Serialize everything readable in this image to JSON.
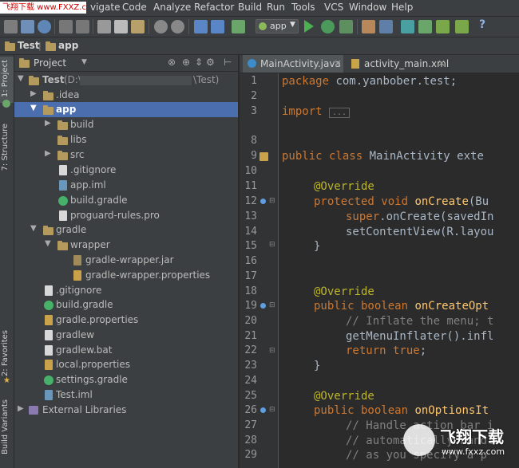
{
  "watermark": {
    "top": "飞翔下载 www.FXXZ.com",
    "bottom_title": "飞翔下载",
    "bottom_url": "www.fxxz.com"
  },
  "menu": [
    "vigate",
    "Code",
    "Analyze",
    "Refactor",
    "Build",
    "Run",
    "Tools",
    "VCS",
    "Window",
    "Help"
  ],
  "toolbar": {
    "run_config": "app",
    "help": "?"
  },
  "breadcrumb": [
    "Test",
    "app"
  ],
  "stripe": {
    "project": "1: Project",
    "structure": "7: Structure",
    "favorites": "2: Favorites",
    "build_variants": "Build Variants"
  },
  "panel": {
    "title": "Project"
  },
  "tree": [
    {
      "label": "Test",
      "label_suffix": "(D:\\",
      "label_end": "\\Test)",
      "depth": 0,
      "arrow": "▼",
      "icon": "folder-icon"
    },
    {
      "label": ".idea",
      "depth": 1,
      "arrow": "▶",
      "icon": "folder-icon"
    },
    {
      "label": "app",
      "depth": 1,
      "arrow": "▼",
      "icon": "folder-icon",
      "selected": true
    },
    {
      "label": "build",
      "depth": 2,
      "arrow": "▶",
      "icon": "folder-icon"
    },
    {
      "label": "libs",
      "depth": 2,
      "arrow": "",
      "icon": "folder-icon"
    },
    {
      "label": "src",
      "depth": 2,
      "arrow": "▶",
      "icon": "folder-icon"
    },
    {
      "label": ".gitignore",
      "depth": 2,
      "arrow": "",
      "icon": "file-icon"
    },
    {
      "label": "app.iml",
      "depth": 2,
      "arrow": "",
      "icon": "iml-icon"
    },
    {
      "label": "build.gradle",
      "depth": 2,
      "arrow": "",
      "icon": "gradle-icon"
    },
    {
      "label": "proguard-rules.pro",
      "depth": 2,
      "arrow": "",
      "icon": "file-icon"
    },
    {
      "label": "gradle",
      "depth": 1,
      "arrow": "▼",
      "icon": "folder-icon"
    },
    {
      "label": "wrapper",
      "depth": 2,
      "arrow": "▼",
      "icon": "folder-icon"
    },
    {
      "label": "gradle-wrapper.jar",
      "depth": 3,
      "arrow": "",
      "icon": "jar-icon"
    },
    {
      "label": "gradle-wrapper.properties",
      "depth": 3,
      "arrow": "",
      "icon": "properties-icon"
    },
    {
      "label": ".gitignore",
      "depth": 1,
      "arrow": "",
      "icon": "file-icon"
    },
    {
      "label": "build.gradle",
      "depth": 1,
      "arrow": "",
      "icon": "gradle-icon"
    },
    {
      "label": "gradle.properties",
      "depth": 1,
      "arrow": "",
      "icon": "properties-icon"
    },
    {
      "label": "gradlew",
      "depth": 1,
      "arrow": "",
      "icon": "file-icon"
    },
    {
      "label": "gradlew.bat",
      "depth": 1,
      "arrow": "",
      "icon": "file-icon"
    },
    {
      "label": "local.properties",
      "depth": 1,
      "arrow": "",
      "icon": "properties-icon"
    },
    {
      "label": "settings.gradle",
      "depth": 1,
      "arrow": "",
      "icon": "gradle-icon"
    },
    {
      "label": "Test.iml",
      "depth": 1,
      "arrow": "",
      "icon": "iml-icon"
    },
    {
      "label": "External Libraries",
      "depth": 0,
      "arrow": "▶",
      "icon": "library-icon"
    }
  ],
  "tabs": [
    {
      "label": "MainActivity.java",
      "close": "×",
      "active": true
    },
    {
      "label": "activity_main.xml",
      "close": "×",
      "active": false
    }
  ],
  "line_numbers": [
    "1",
    "2",
    "3",
    "8",
    "9",
    "10",
    "11",
    "12",
    "13",
    "14",
    "15",
    "16",
    "17",
    "18",
    "19",
    "20",
    "21",
    "22",
    "23",
    "24",
    "25",
    "26",
    "27",
    "28",
    "29"
  ],
  "code": {
    "l1_kw": "package",
    "l1_rest": " com.yanbober.test;",
    "l3_kw": "import",
    "l3_fold": "...",
    "l9_kw": "public class",
    "l9_rest": " MainActivity exte",
    "override": "@Override",
    "l12_kw": "protected void",
    "l12_fn": " onCreate",
    "l12_rest": "(Bu",
    "l13_kw": "super",
    "l13_rest": ".onCreate(savedIn",
    "l14": "setContentView(R.layou",
    "brace": "}",
    "l19_kw": "public boolean",
    "l19_fn": " onCreateOpt",
    "l20": "// Inflate the menu; t",
    "l21": "getMenuInflater().infl",
    "l22_kw": "return true",
    "l22_rest": ";",
    "l26_kw": "public boolean",
    "l26_fn": " onOptionsIt",
    "l27": "// Handle action bar i",
    "l28": "// automatically handl",
    "l29": "// as you specify a p"
  }
}
